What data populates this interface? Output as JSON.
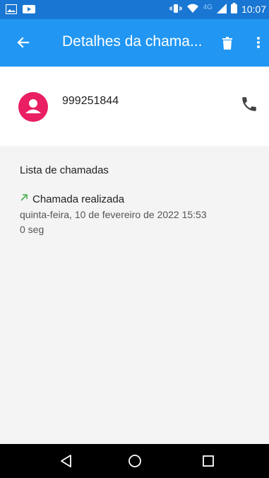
{
  "status_bar": {
    "time": "10:07",
    "network": "4G",
    "icons": [
      "gallery-icon",
      "video-icon",
      "vibrate-icon",
      "wifi-icon",
      "signal-icon",
      "battery-icon"
    ]
  },
  "app_bar": {
    "title": "Detalhes da chama...",
    "icons": [
      "back-arrow-icon",
      "delete-icon",
      "more-vert-icon"
    ],
    "color": "#2196f3",
    "status_color": "#1976d2"
  },
  "contact": {
    "number": "999251844",
    "avatar_color": "#e91e63"
  },
  "call_list": {
    "header": "Lista de chamadas",
    "entries": [
      {
        "type": "Chamada realizada",
        "date": "quinta-feira, 10 de fevereiro de 2022 15:53",
        "duration": "0 seg",
        "arrow_color": "#4caf50"
      }
    ]
  },
  "nav_bar": {
    "icons": [
      "back-triangle-icon",
      "home-circle-icon",
      "recents-square-icon"
    ]
  }
}
